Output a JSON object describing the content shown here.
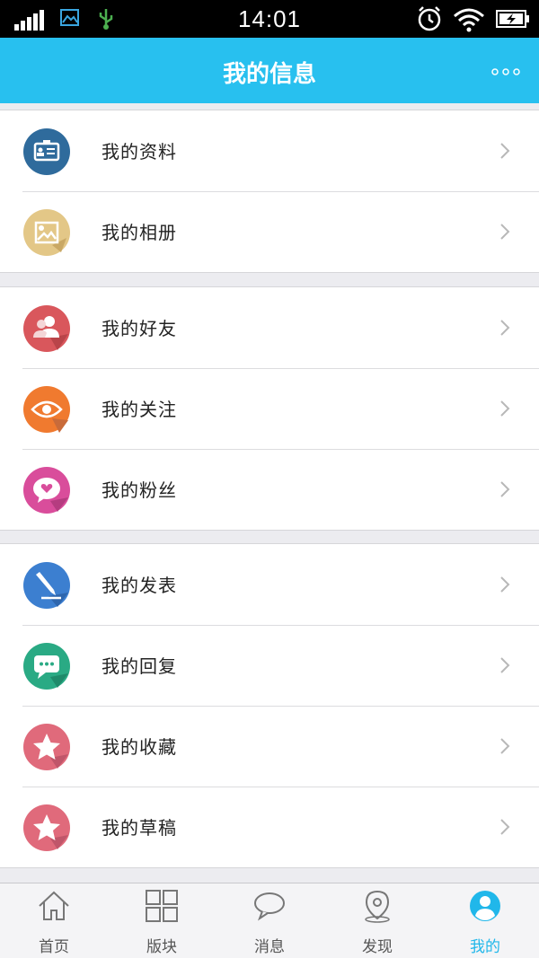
{
  "status_bar": {
    "time": "14:01",
    "icons": [
      "signal-icon",
      "gallery-icon",
      "usb-icon",
      "alarm-icon",
      "wifi-icon",
      "battery-charging-icon"
    ]
  },
  "header": {
    "title": "我的信息",
    "more_icon": "more-dots-icon"
  },
  "colors": {
    "header": "#28c0ef",
    "active_tab": "#20b7ea"
  },
  "menu_groups": [
    {
      "items": [
        {
          "label": "我的资料",
          "icon": "id-card-icon",
          "color": "#2f6b9c"
        },
        {
          "label": "我的相册",
          "icon": "picture-icon",
          "color": "#e3c787"
        }
      ]
    },
    {
      "items": [
        {
          "label": "我的好友",
          "icon": "friends-icon",
          "color": "#d9575c"
        },
        {
          "label": "我的关注",
          "icon": "eye-icon",
          "color": "#f07a2f"
        },
        {
          "label": "我的粉丝",
          "icon": "heart-chat-icon",
          "color": "#d94d9b"
        }
      ]
    },
    {
      "items": [
        {
          "label": "我的发表",
          "icon": "pen-icon",
          "color": "#3c7fd0"
        },
        {
          "label": "我的回复",
          "icon": "chat-bubble-icon",
          "color": "#2aaa84"
        },
        {
          "label": "我的收藏",
          "icon": "star-icon",
          "color": "#e06a7b"
        },
        {
          "label": "我的草稿",
          "icon": "star-icon",
          "color": "#e06a7b"
        }
      ]
    }
  ],
  "tabs": [
    {
      "label": "首页",
      "icon": "home-icon",
      "active": false
    },
    {
      "label": "版块",
      "icon": "grid-icon",
      "active": false
    },
    {
      "label": "消息",
      "icon": "message-icon",
      "active": false
    },
    {
      "label": "发现",
      "icon": "location-icon",
      "active": false
    },
    {
      "label": "我的",
      "icon": "user-icon",
      "active": true
    }
  ]
}
